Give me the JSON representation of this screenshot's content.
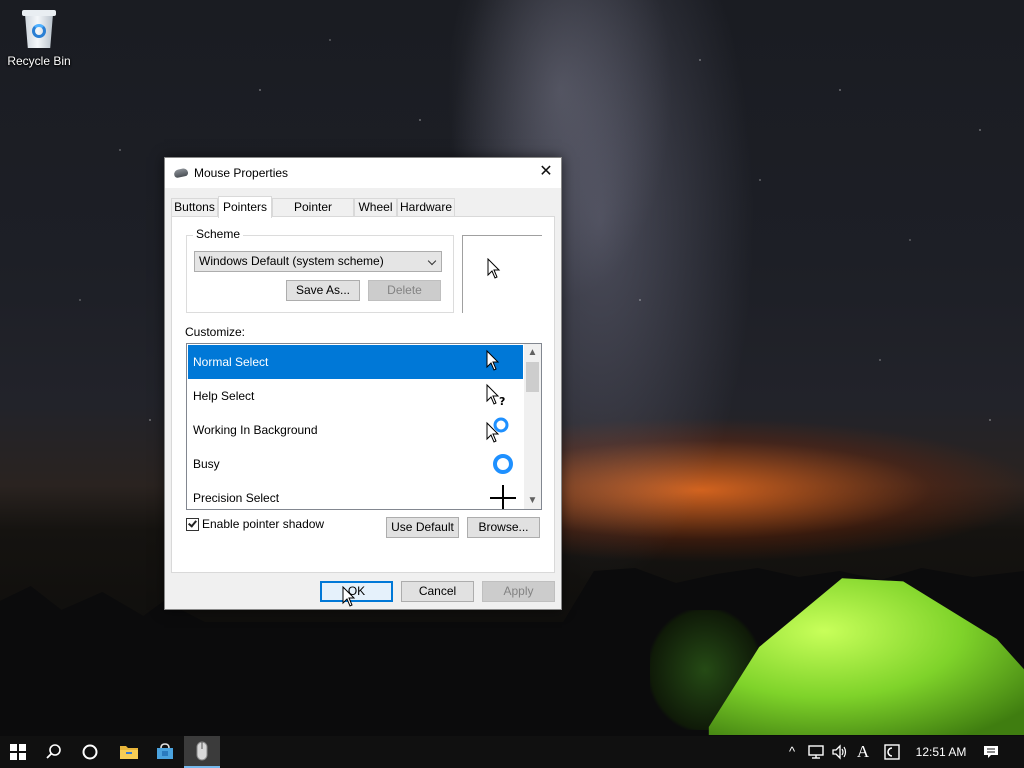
{
  "desktop": {
    "icons": [
      {
        "label": "Recycle Bin",
        "icon": "recycle-bin-icon"
      }
    ]
  },
  "dialog": {
    "title": "Mouse Properties",
    "close_glyph": "✕",
    "tabs": [
      {
        "label": "Buttons"
      },
      {
        "label": "Pointers",
        "active": true
      },
      {
        "label": "Pointer Options"
      },
      {
        "label": "Wheel"
      },
      {
        "label": "Hardware"
      }
    ],
    "scheme": {
      "group_label": "Scheme",
      "selected": "Windows Default (system scheme)",
      "save_as_label": "Save As...",
      "delete_label": "Delete"
    },
    "customize": {
      "label": "Customize:",
      "items": [
        {
          "label": "Normal Select",
          "cursor": "arrow-cursor-icon",
          "selected": true
        },
        {
          "label": "Help Select",
          "cursor": "help-cursor-icon"
        },
        {
          "label": "Working In Background",
          "cursor": "working-cursor-icon"
        },
        {
          "label": "Busy",
          "cursor": "busy-cursor-icon"
        },
        {
          "label": "Precision Select",
          "cursor": "crosshair-cursor-icon"
        }
      ],
      "scroll_up_glyph": "▲",
      "scroll_down_glyph": "▼"
    },
    "enable_shadow": {
      "label": "Enable pointer shadow",
      "checked": true
    },
    "use_default_label": "Use Default",
    "browse_label": "Browse...",
    "ok_label": "OK",
    "cancel_label": "Cancel",
    "apply_label": "Apply"
  },
  "taskbar": {
    "items": [
      "start-button",
      "search-icon",
      "cortana-icon",
      "file-explorer-icon",
      "store-icon",
      "mouse-properties-icon"
    ],
    "tray": {
      "chevron_glyph": "^",
      "ime_label": "A",
      "time": "12:51 AM"
    }
  },
  "colors": {
    "accent": "#0078d7",
    "selection": "#0078d7",
    "taskbar": "#101010",
    "tent_green": "#7fd32a"
  }
}
